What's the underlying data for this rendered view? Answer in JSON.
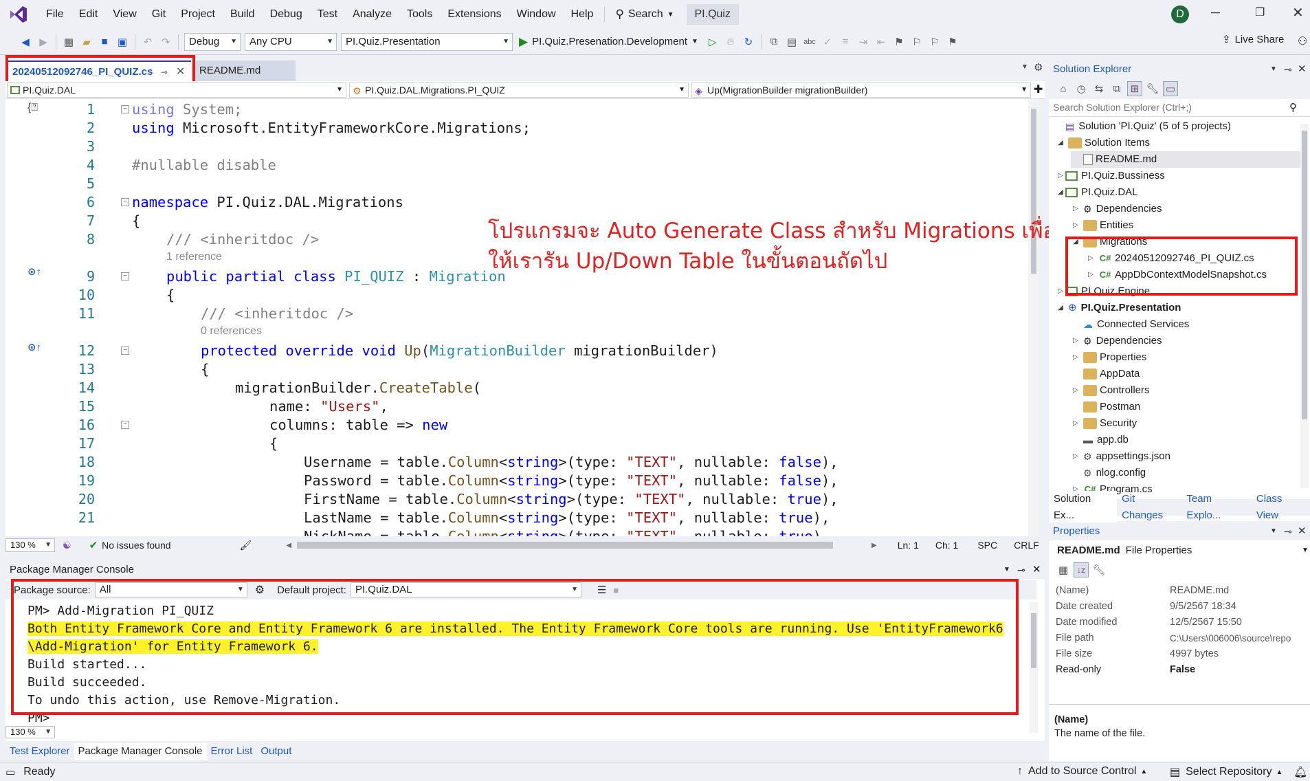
{
  "menubar": {
    "items": [
      "File",
      "Edit",
      "View",
      "Git",
      "Project",
      "Build",
      "Debug",
      "Test",
      "Analyze",
      "Tools",
      "Extensions",
      "Window",
      "Help"
    ],
    "search_label": "Search",
    "solution_name": "PI.Quiz",
    "avatar_initial": "D"
  },
  "toolbar": {
    "config": "Debug",
    "platform": "Any CPU",
    "startup_project": "PI.Quiz.Presentation",
    "run_profile": "PI.Quiz.Presenation.Development",
    "live_share": "Live Share"
  },
  "tabs": [
    {
      "label": "20240512092746_PI_QUIZ.cs",
      "active": true
    },
    {
      "label": "README.md",
      "active": false
    }
  ],
  "navbar": {
    "project": "PI.Quiz.DAL",
    "type": "PI.Quiz.DAL.Migrations.PI_QUIZ",
    "member": "Up(MigrationBuilder migrationBuilder)"
  },
  "code": {
    "line_numbers": [
      "1",
      "2",
      "3",
      "4",
      "5",
      "6",
      "7",
      "8",
      "9",
      "10",
      "11",
      "12",
      "13",
      "14",
      "15",
      "16",
      "17",
      "18",
      "19",
      "20",
      "21"
    ],
    "l1_kw": "using",
    "l1_rest": " System;",
    "l2_kw": "using",
    "l2_rest": " Microsoft.EntityFrameworkCore.Migrations;",
    "l4": "#nullable disable",
    "l6_kw": "namespace",
    "l6_rest": " PI.Quiz.DAL.Migrations",
    "brace_open": "{",
    "l8": "/// <inheritdoc />",
    "ref1": "1 reference",
    "l9_kw": "public partial class",
    "l9_name": " PI_QUIZ",
    "l9_colon": " : ",
    "l9_base": "Migration",
    "l11": "/// <inheritdoc />",
    "ref0": "0 references",
    "l12_kw": "protected override void",
    "l12_fn": " Up",
    "l12_p1": "(",
    "l12_type": "MigrationBuilder",
    "l12_p2": " migrationBuilder)",
    "l14_a": "migrationBuilder.",
    "l14_fn": "CreateTable",
    "l14_b": "(",
    "l15_a": "name: ",
    "l15_str": "\"Users\"",
    "l15_b": ",",
    "l16_a": "columns: table => ",
    "l16_kw": "new",
    "cols": [
      {
        "name": "Username",
        "nullable": "false"
      },
      {
        "name": "Password",
        "nullable": "false"
      },
      {
        "name": "FirstName",
        "nullable": "true"
      },
      {
        "name": "LastName",
        "nullable": "true"
      },
      {
        "name": "NickName",
        "nullable": "true"
      }
    ],
    "col_mid1": " = table.",
    "col_fn": "Column",
    "col_lt": "<",
    "col_string": "string",
    "col_gt": ">(type: ",
    "col_text": "\"TEXT\"",
    "col_null": ", nullable: ",
    "col_end": "),"
  },
  "annotation": {
    "line1": "โปรแกรมจะ Auto Generate Class สำหรับ Migrations เพื่อ",
    "line2": "ให้เรารัน Up/Down Table ในขั้นตอนถัดไป"
  },
  "editor_status": {
    "zoom": "130 %",
    "issues": "No issues found",
    "ln": "Ln: 1",
    "ch": "Ch: 1",
    "spc": "SPC",
    "crlf": "CRLF"
  },
  "pmc": {
    "title": "Package Manager Console",
    "source_label": "Package source:",
    "source_value": "All",
    "default_project_label": "Default project:",
    "default_project_value": "PI.Quiz.DAL",
    "lines": [
      "PM> Add-Migration PI_QUIZ",
      "Both Entity Framework Core and Entity Framework 6 are installed. The Entity Framework Core tools are running. Use 'EntityFramework6",
      "\\Add-Migration' for Entity Framework 6.",
      "Build started...",
      "Build succeeded.",
      "To undo this action, use Remove-Migration.",
      "PM>"
    ],
    "zoom": "130 %"
  },
  "bottom_tabs": [
    "Test Explorer",
    "Package Manager Console",
    "Error List",
    "Output"
  ],
  "status": {
    "ready": "Ready",
    "add_source": "Add to Source Control",
    "select_repo": "Select Repository"
  },
  "solution_explorer": {
    "title": "Solution Explorer",
    "search_placeholder": "Search Solution Explorer (Ctrl+;)",
    "items": [
      {
        "label": "Solution 'PI.Quiz' (5 of 5 projects)"
      },
      {
        "label": "Solution Items"
      },
      {
        "label": "README.md"
      },
      {
        "label": "PI.Quiz.Bussiness"
      },
      {
        "label": "PI.Quiz.DAL"
      },
      {
        "label": "Dependencies"
      },
      {
        "label": "Entities"
      },
      {
        "label": "Migrations"
      },
      {
        "label": "20240512092746_PI_QUIZ.cs"
      },
      {
        "label": "AppDbContextModelSnapshot.cs"
      },
      {
        "label": "PI.Quiz.Engine"
      },
      {
        "label": "PI.Quiz.Presentation"
      },
      {
        "label": "Connected Services"
      },
      {
        "label": "Dependencies"
      },
      {
        "label": "Properties"
      },
      {
        "label": "AppData"
      },
      {
        "label": "Controllers"
      },
      {
        "label": "Postman"
      },
      {
        "label": "Security"
      },
      {
        "label": "app.db"
      },
      {
        "label": "appsettings.json"
      },
      {
        "label": "nlog.config"
      },
      {
        "label": "Program.cs"
      }
    ],
    "tabs": [
      "Solution Ex...",
      "Git Changes",
      "Team Explo...",
      "Class View"
    ]
  },
  "properties": {
    "title": "Properties",
    "subject": "README.md",
    "subject_kind": "File Properties",
    "rows": [
      {
        "k": "(Name)",
        "v": "README.md"
      },
      {
        "k": "Date created",
        "v": "9/5/2567 18:34"
      },
      {
        "k": "Date modified",
        "v": "12/5/2567 15:50"
      },
      {
        "k": "File path",
        "v": "C:\\Users\\006006\\source\\repo"
      },
      {
        "k": "File size",
        "v": "4997 bytes"
      },
      {
        "k": "Read-only",
        "v": "False"
      }
    ],
    "desc_title": "(Name)",
    "desc_text": "The name of the file."
  },
  "colors": {
    "accent": "#5c2d91",
    "highlight": "#fff22a",
    "annotation": "#e52020",
    "run": "#1e8a1e"
  }
}
